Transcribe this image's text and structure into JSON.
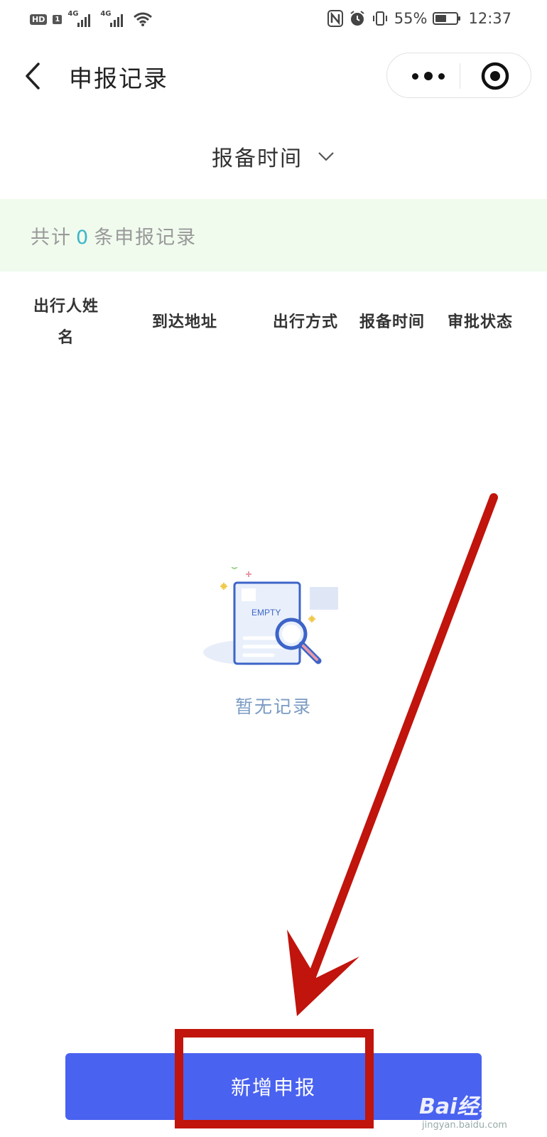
{
  "status_bar": {
    "left_badges": [
      "HD",
      "1"
    ],
    "signal_labels": [
      "4G",
      "4G"
    ],
    "battery_text": "55%",
    "battery_level": 0.55,
    "time": "12:37"
  },
  "nav": {
    "title": "申报记录",
    "icons": {
      "back": "chevron-left-icon",
      "more": "more-dots-icon",
      "close": "target-circle-icon"
    }
  },
  "filter": {
    "label": "报备时间",
    "icon": "chevron-down-icon"
  },
  "summary": {
    "prefix": "共计",
    "count": "0",
    "suffix": "条申报记录",
    "count_color": "#3bb5c8"
  },
  "table": {
    "columns": [
      "出行人姓名",
      "到达地址",
      "出行方式",
      "报备时间",
      "审批状态"
    ]
  },
  "empty": {
    "illustration_text": "EMPTY",
    "message": "暂无记录"
  },
  "button": {
    "label": "新增申报",
    "color": "#4a62f0"
  },
  "annotation": {
    "color": "#c0140c"
  },
  "watermark": {
    "text": "Bai经验",
    "sub": "jingyan.baidu.com"
  }
}
